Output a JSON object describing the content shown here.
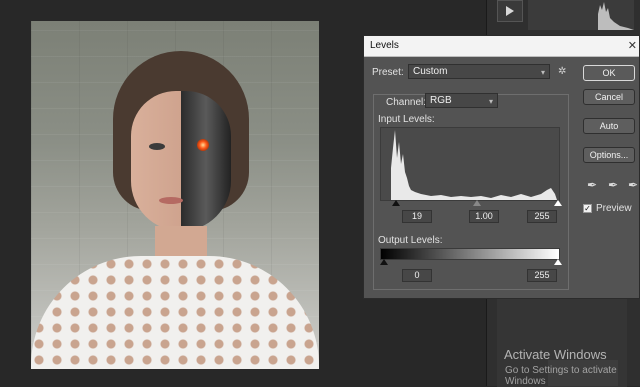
{
  "dialog": {
    "title": "Levels",
    "close_glyph": "✕",
    "preset_label": "Preset:",
    "preset_value": "Custom",
    "channel_label": "Channel:",
    "channel_value": "RGB",
    "input_levels_label": "Input Levels:",
    "input_black": "19",
    "input_gamma": "1.00",
    "input_white": "255",
    "output_levels_label": "Output Levels:",
    "output_black": "0",
    "output_white": "255",
    "buttons": {
      "ok": "OK",
      "cancel": "Cancel",
      "auto": "Auto",
      "options": "Options..."
    },
    "preview_label": "Preview",
    "preview_checked": true
  },
  "watermark": {
    "title": "Activate Windows",
    "subtitle": "Go to Settings to activate Windows"
  },
  "icons": {
    "gear": "gear-icon",
    "eyedropper_black": "eyedropper-black-icon",
    "eyedropper_gray": "eyedropper-gray-icon",
    "eyedropper_white": "eyedropper-white-icon",
    "play": "play-icon"
  },
  "colors": {
    "dialog_bg": "#535353",
    "app_bg": "#282828",
    "titlebar_bg": "#f3f3f3"
  }
}
